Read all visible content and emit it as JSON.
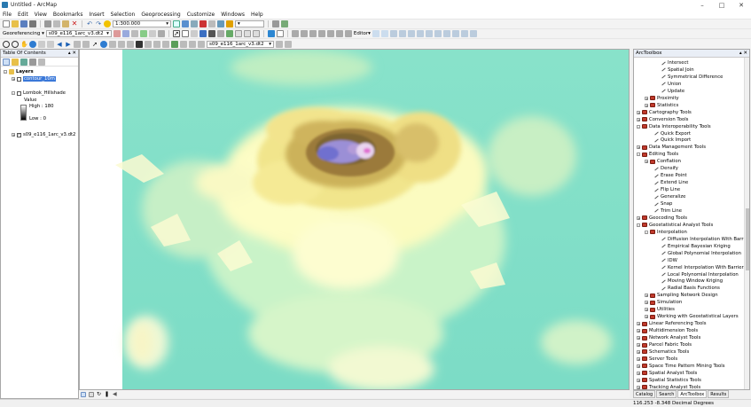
{
  "window": {
    "title": "Untitled - ArcMap"
  },
  "menu": [
    "File",
    "Edit",
    "View",
    "Bookmarks",
    "Insert",
    "Selection",
    "Geoprocessing",
    "Customize",
    "Windows",
    "Help"
  ],
  "toolbar": {
    "scale": "1:300.000",
    "georeferencing_label": "Georeferencing ▾",
    "georef_layer": "s09_e116_1arc_v3.dt2",
    "editor_label": "Editor▾",
    "layer_select": "s09_e116_1arc_v3.dt2"
  },
  "toc": {
    "title": "Table Of Contents",
    "layers_root": "Layers",
    "items": [
      {
        "name": "contour_10m",
        "checked": false,
        "selected": true
      },
      {
        "name": "Lombok_Hillshade",
        "checked": false
      },
      {
        "name": "s09_e116_1arc_v3.dt2",
        "checked": true
      }
    ],
    "legend": {
      "value_label": "Value",
      "high": "High : 180",
      "low": "Low : 0"
    }
  },
  "arctoolbox": {
    "title": "ArcToolbox",
    "tree": [
      {
        "label": "Intersect",
        "kind": "tool",
        "level": 3
      },
      {
        "label": "Spatial Join",
        "kind": "tool",
        "level": 3
      },
      {
        "label": "Symmetrical Difference",
        "kind": "tool",
        "level": 3
      },
      {
        "label": "Union",
        "kind": "tool",
        "level": 3
      },
      {
        "label": "Update",
        "kind": "tool",
        "level": 3
      },
      {
        "label": "Proximity",
        "kind": "toolset",
        "level": 2
      },
      {
        "label": "Statistics",
        "kind": "toolset",
        "level": 2
      },
      {
        "label": "Cartography Tools",
        "kind": "box",
        "level": 1
      },
      {
        "label": "Conversion Tools",
        "kind": "box",
        "level": 1
      },
      {
        "label": "Data Interoperability Tools",
        "kind": "box",
        "level": 1,
        "open": true
      },
      {
        "label": "Quick Export",
        "kind": "tool",
        "level": 2
      },
      {
        "label": "Quick Import",
        "kind": "tool",
        "level": 2
      },
      {
        "label": "Data Management Tools",
        "kind": "box",
        "level": 1
      },
      {
        "label": "Editing Tools",
        "kind": "box",
        "level": 1,
        "open": true
      },
      {
        "label": "Conflation",
        "kind": "toolset",
        "level": 2
      },
      {
        "label": "Densify",
        "kind": "tool",
        "level": 2
      },
      {
        "label": "Erase Point",
        "kind": "tool",
        "level": 2
      },
      {
        "label": "Extend Line",
        "kind": "tool",
        "level": 2
      },
      {
        "label": "Flip Line",
        "kind": "tool",
        "level": 2
      },
      {
        "label": "Generalize",
        "kind": "tool",
        "level": 2
      },
      {
        "label": "Snap",
        "kind": "tool",
        "level": 2
      },
      {
        "label": "Trim Line",
        "kind": "tool",
        "level": 2
      },
      {
        "label": "Geocoding Tools",
        "kind": "box",
        "level": 1
      },
      {
        "label": "Geostatistical Analyst Tools",
        "kind": "box",
        "level": 1,
        "open": true
      },
      {
        "label": "Interpolation",
        "kind": "toolset",
        "level": 2,
        "open": true
      },
      {
        "label": "Diffusion Interpolation With Barriers",
        "kind": "tool",
        "level": 3
      },
      {
        "label": "Empirical Bayesian Kriging",
        "kind": "tool",
        "level": 3
      },
      {
        "label": "Global Polynomial Interpolation",
        "kind": "tool",
        "level": 3
      },
      {
        "label": "IDW",
        "kind": "tool",
        "level": 3
      },
      {
        "label": "Kernel Interpolation With Barriers",
        "kind": "tool",
        "level": 3
      },
      {
        "label": "Local Polynomial Interpolation",
        "kind": "tool",
        "level": 3
      },
      {
        "label": "Moving Window Kriging",
        "kind": "tool",
        "level": 3
      },
      {
        "label": "Radial Basis Functions",
        "kind": "tool",
        "level": 3
      },
      {
        "label": "Sampling Network Design",
        "kind": "toolset",
        "level": 2
      },
      {
        "label": "Simulation",
        "kind": "toolset",
        "level": 2
      },
      {
        "label": "Utilities",
        "kind": "toolset",
        "level": 2
      },
      {
        "label": "Working with Geostatistical Layers",
        "kind": "toolset",
        "level": 2
      },
      {
        "label": "Linear Referencing Tools",
        "kind": "box",
        "level": 1
      },
      {
        "label": "Multidimension Tools",
        "kind": "box",
        "level": 1
      },
      {
        "label": "Network Analyst Tools",
        "kind": "box",
        "level": 1
      },
      {
        "label": "Parcel Fabric Tools",
        "kind": "box",
        "level": 1
      },
      {
        "label": "Schematics Tools",
        "kind": "box",
        "level": 1
      },
      {
        "label": "Server Tools",
        "kind": "box",
        "level": 1
      },
      {
        "label": "Space Time Pattern Mining Tools",
        "kind": "box",
        "level": 1
      },
      {
        "label": "Spatial Analyst Tools",
        "kind": "box",
        "level": 1
      },
      {
        "label": "Spatial Statistics Tools",
        "kind": "box",
        "level": 1
      },
      {
        "label": "Tracking Analyst Tools",
        "kind": "box",
        "level": 1
      }
    ]
  },
  "bottom_tabs": [
    "Catalog",
    "Search",
    "ArcToolbox",
    "Results"
  ],
  "status": {
    "coordinates": "116.253  -8.348 Decimal Degrees"
  },
  "colors": {
    "dem_low": "#7fe0c5",
    "dem_mid": "#fdfdc0",
    "dem_high": "#a37a3a",
    "dem_peak": "#8b7fd8"
  }
}
